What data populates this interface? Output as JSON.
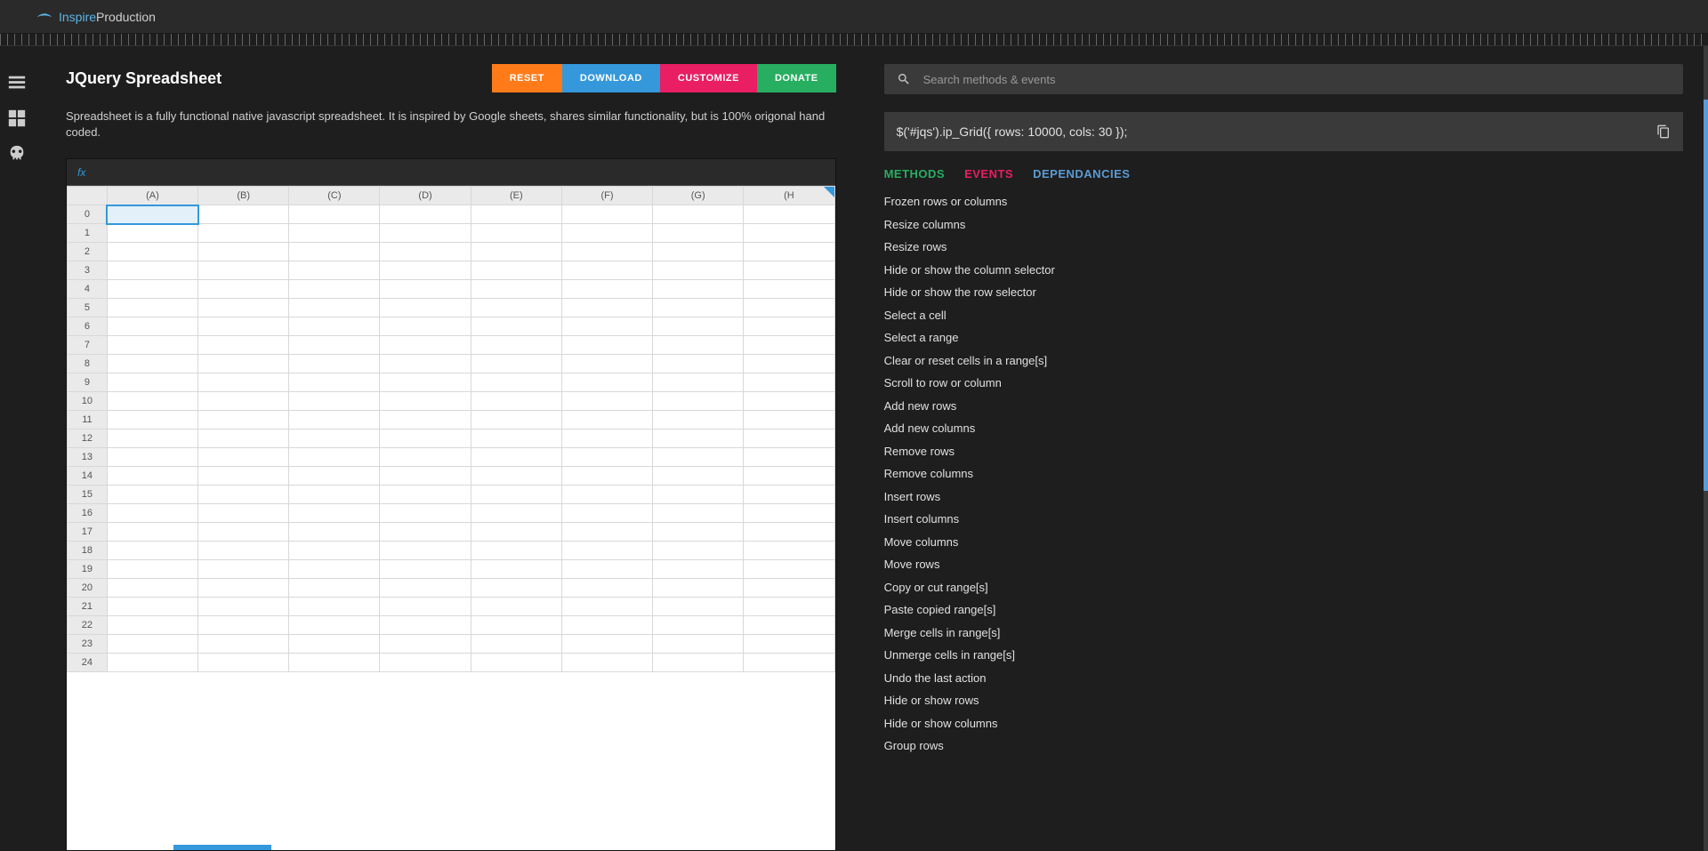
{
  "brand": {
    "inspire": "Inspire",
    "production": "Production"
  },
  "page": {
    "title": "JQuery Spreadsheet",
    "description": "Spreadsheet is a fully functional native javascript spreadsheet. It is inspired by Google sheets, shares similar functionality, but is 100% origonal hand coded."
  },
  "buttons": {
    "reset": "RESET",
    "download": "DOWNLOAD",
    "customize": "CUSTOMIZE",
    "donate": "DONATE"
  },
  "spreadsheet": {
    "fx_label": "fx",
    "columns": [
      "(A)",
      "(B)",
      "(C)",
      "(D)",
      "(E)",
      "(F)",
      "(G)",
      "(H"
    ],
    "rows": [
      "0",
      "1",
      "2",
      "3",
      "4",
      "5",
      "6",
      "7",
      "8",
      "9",
      "10",
      "11",
      "12",
      "13",
      "14",
      "15",
      "16",
      "17",
      "18",
      "19",
      "20",
      "21",
      "22",
      "23",
      "24"
    ]
  },
  "search": {
    "placeholder": "Search methods & events"
  },
  "code": "$('#jqs').ip_Grid({ rows: 10000, cols: 30 });",
  "tabs": {
    "methods": "METHODS",
    "events": "EVENTS",
    "deps": "DEPENDANCIES"
  },
  "methods": [
    "Frozen rows or columns",
    "Resize columns",
    "Resize rows",
    "Hide or show the column selector",
    "Hide or show the row selector",
    "Select a cell",
    "Select a range",
    "Clear or reset cells in a range[s]",
    "Scroll to row or column",
    "Add new rows",
    "Add new columns",
    "Remove rows",
    "Remove columns",
    "Insert rows",
    "Insert columns",
    "Move columns",
    "Move rows",
    "Copy or cut range[s]",
    "Paste copied range[s]",
    "Merge cells in range[s]",
    "Unmerge cells in range[s]",
    "Undo the last action",
    "Hide or show rows",
    "Hide or show columns",
    "Group rows"
  ]
}
